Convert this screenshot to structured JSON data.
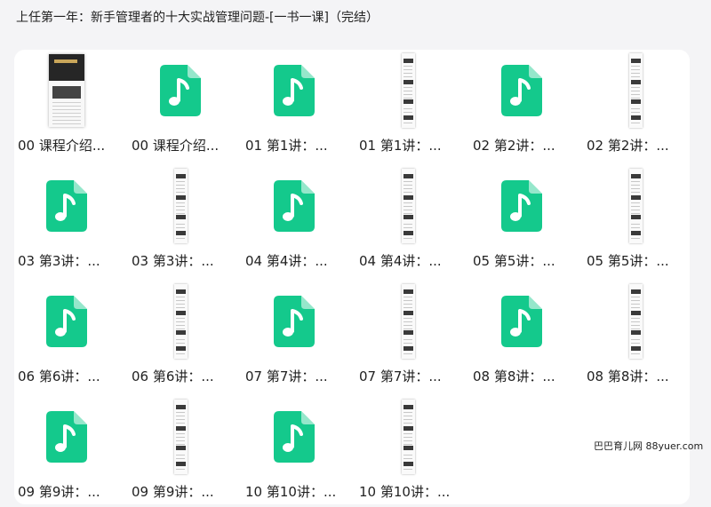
{
  "title": "上任第一年：新手管理者的十大实战管理问题-[一书一课]（完结）",
  "watermark": "巴巴育儿网 88yuer.com",
  "colors": {
    "audio_icon": "#14c98c",
    "panel": "#ffffff",
    "background": "#f4f4f6"
  },
  "files": [
    {
      "label": "00 课程介绍...",
      "kind": "cover",
      "icon": "image-thumbnail"
    },
    {
      "label": "00 课程介绍...",
      "kind": "audio",
      "icon": "audio-file-icon"
    },
    {
      "label": "01 第1讲：...",
      "kind": "audio",
      "icon": "audio-file-icon"
    },
    {
      "label": "01 第1讲：...",
      "kind": "image",
      "icon": "image-thumbnail"
    },
    {
      "label": "02 第2讲：...",
      "kind": "audio",
      "icon": "audio-file-icon"
    },
    {
      "label": "02 第2讲：...",
      "kind": "image",
      "icon": "image-thumbnail"
    },
    {
      "label": "03 第3讲：...",
      "kind": "audio",
      "icon": "audio-file-icon"
    },
    {
      "label": "03 第3讲：...",
      "kind": "image",
      "icon": "image-thumbnail"
    },
    {
      "label": "04 第4讲：...",
      "kind": "audio",
      "icon": "audio-file-icon"
    },
    {
      "label": "04 第4讲：...",
      "kind": "image",
      "icon": "image-thumbnail"
    },
    {
      "label": "05 第5讲：...",
      "kind": "audio",
      "icon": "audio-file-icon"
    },
    {
      "label": "05 第5讲：...",
      "kind": "image",
      "icon": "image-thumbnail"
    },
    {
      "label": "06 第6讲：...",
      "kind": "audio",
      "icon": "audio-file-icon"
    },
    {
      "label": "06 第6讲：...",
      "kind": "image",
      "icon": "image-thumbnail"
    },
    {
      "label": "07 第7讲：...",
      "kind": "audio",
      "icon": "audio-file-icon"
    },
    {
      "label": "07 第7讲：...",
      "kind": "image",
      "icon": "image-thumbnail"
    },
    {
      "label": "08 第8讲：...",
      "kind": "audio",
      "icon": "audio-file-icon"
    },
    {
      "label": "08 第8讲：...",
      "kind": "image",
      "icon": "image-thumbnail"
    },
    {
      "label": "09 第9讲：...",
      "kind": "audio",
      "icon": "audio-file-icon"
    },
    {
      "label": "09 第9讲：...",
      "kind": "image",
      "icon": "image-thumbnail"
    },
    {
      "label": "10 第10讲：...",
      "kind": "audio",
      "icon": "audio-file-icon"
    },
    {
      "label": "10 第10讲：...",
      "kind": "image",
      "icon": "image-thumbnail"
    }
  ]
}
